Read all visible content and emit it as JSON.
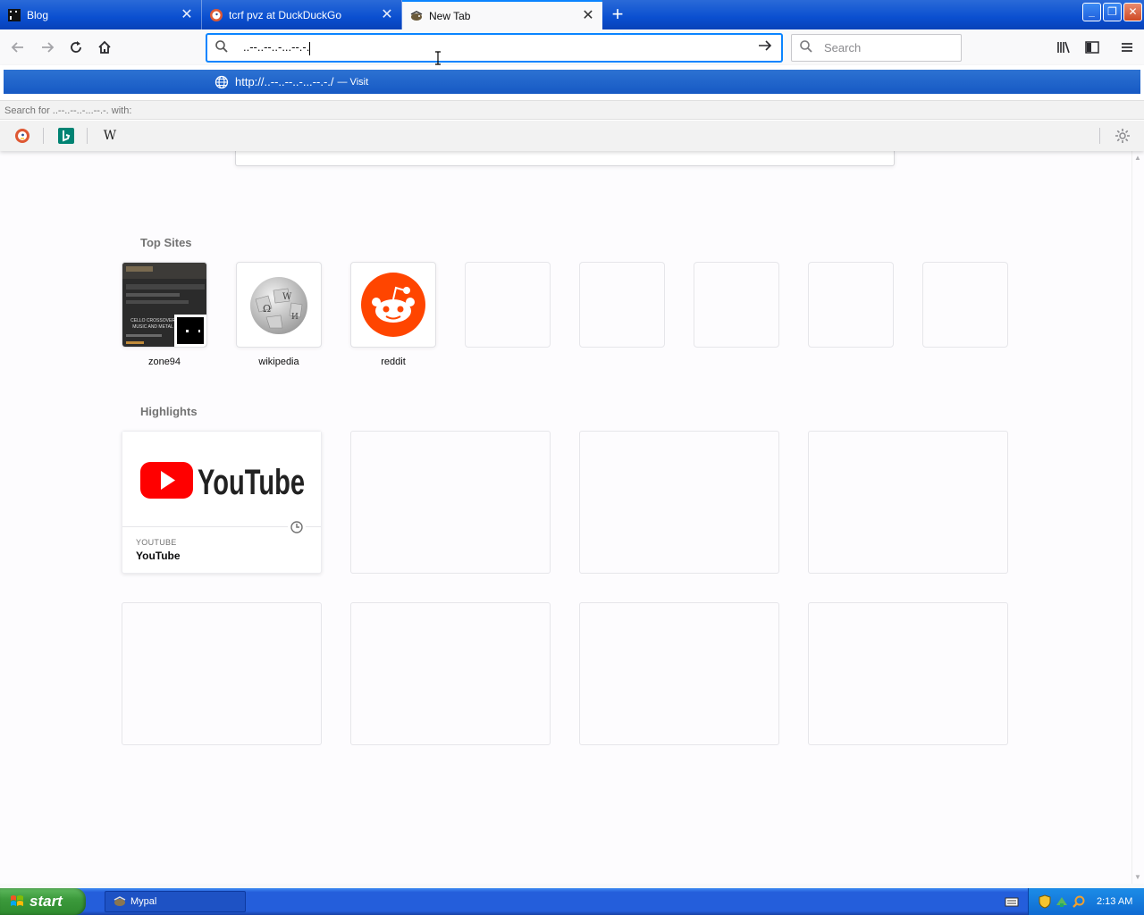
{
  "tabs": [
    {
      "title": "Blog",
      "favicon": "blog-favicon"
    },
    {
      "title": "tcrf pvz at DuckDuckGo",
      "favicon": "duckduckgo-favicon"
    },
    {
      "title": "New Tab",
      "favicon": "mypal-favicon",
      "active": true
    }
  ],
  "urlbar": {
    "value": "..--..--..-...--.-."
  },
  "searchbar": {
    "placeholder": "Search"
  },
  "dropdown": {
    "suggestion_url": "http://..--..--..-...--.-./",
    "suggestion_action": "— Visit",
    "search_for": "Search for ..--..--..-...--.-. with:",
    "engines": [
      "duckduckgo",
      "bing",
      "wikipedia"
    ]
  },
  "top_sites": {
    "title": "Top Sites",
    "sites": [
      {
        "label": "zone94"
      },
      {
        "label": "wikipedia"
      },
      {
        "label": "reddit"
      }
    ],
    "zone94_preview": {
      "heading": "CELLO CROSSOVER MUSIC AND METAL"
    }
  },
  "highlights": {
    "title": "Highlights",
    "cards": [
      {
        "source": "YOUTUBE",
        "title": "YouTube",
        "logo_text": "YouTube"
      }
    ]
  },
  "taskbar": {
    "start_label": "start",
    "task": "Mypal",
    "time": "2:13 AM"
  },
  "colors": {
    "accent": "#0a84ff",
    "taskbar": "#245edb",
    "start": "#3c9a3c",
    "youtube_red": "#ff0000",
    "reddit_orange": "#ff4500"
  }
}
